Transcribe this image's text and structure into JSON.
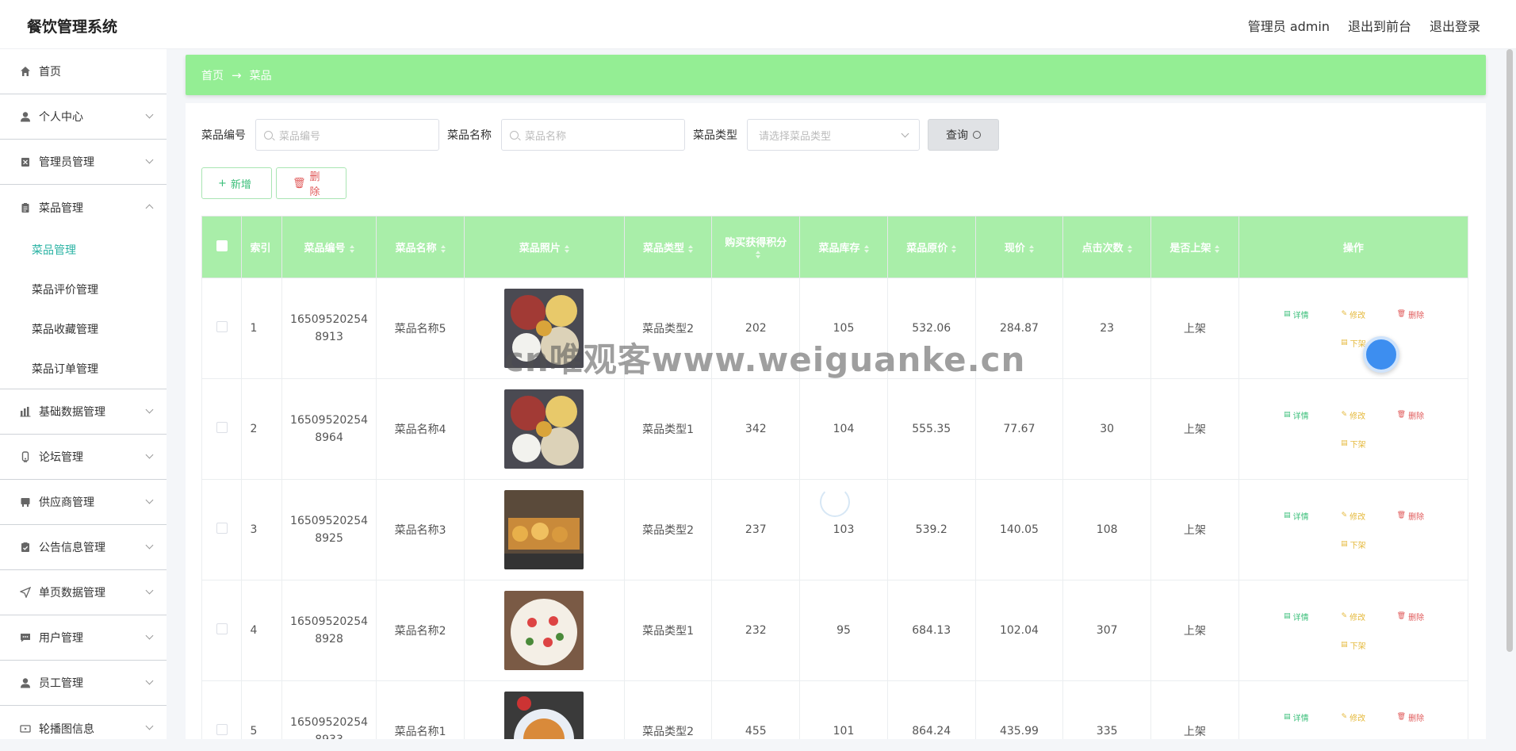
{
  "app": {
    "title": "餐饮管理系统"
  },
  "header": {
    "user_label": "管理员 admin",
    "to_front": "退出到前台",
    "logout": "退出登录"
  },
  "sidebar": {
    "items": [
      {
        "label": "首页",
        "icon": "home-icon"
      },
      {
        "label": "个人中心",
        "icon": "user-icon"
      },
      {
        "label": "管理员管理",
        "icon": "admin-icon"
      },
      {
        "label": "菜品管理",
        "icon": "clipboard-icon",
        "expanded": true
      },
      {
        "label": "基础数据管理",
        "icon": "chart-icon"
      },
      {
        "label": "论坛管理",
        "icon": "forum-icon"
      },
      {
        "label": "供应商管理",
        "icon": "supplier-icon"
      },
      {
        "label": "公告信息管理",
        "icon": "notice-icon"
      },
      {
        "label": "单页数据管理",
        "icon": "send-icon"
      },
      {
        "label": "用户管理",
        "icon": "chat-icon"
      },
      {
        "label": "员工管理",
        "icon": "staff-icon"
      },
      {
        "label": "轮播图信息",
        "icon": "carousel-icon"
      }
    ],
    "submenu": [
      "菜品管理",
      "菜品评价管理",
      "菜品收藏管理",
      "菜品订单管理"
    ]
  },
  "breadcrumb": {
    "home": "首页",
    "arrow": "→",
    "current": "菜品"
  },
  "search": {
    "code_label": "菜品编号",
    "code_placeholder": "菜品编号",
    "name_label": "菜品名称",
    "name_placeholder": "菜品名称",
    "type_label": "菜品类型",
    "type_placeholder": "请选择菜品类型",
    "query_label": "查询"
  },
  "actions": {
    "add_label": "新增",
    "delete_label": "删除"
  },
  "table": {
    "headers": [
      "索引",
      "菜品编号",
      "菜品名称",
      "菜品照片",
      "菜品类型",
      "购买获得积分",
      "菜品库存",
      "菜品原价",
      "现价",
      "点击次数",
      "是否上架",
      "操作"
    ],
    "ops": {
      "detail": "详情",
      "edit": "修改",
      "remove": "删除",
      "down": "下架"
    },
    "rows": [
      {
        "index": "1",
        "code": "16509520254 8913",
        "name": "菜品名称5",
        "type": "菜品类型2",
        "points": "202",
        "stock": "105",
        "price": "532.06",
        "now": "284.87",
        "clicks": "23",
        "on_sale": "上架",
        "photo": "plate-a"
      },
      {
        "index": "2",
        "code": "16509520254 8964",
        "name": "菜品名称4",
        "type": "菜品类型1",
        "points": "342",
        "stock": "104",
        "price": "555.35",
        "now": "77.67",
        "clicks": "30",
        "on_sale": "上架",
        "photo": "plate-a"
      },
      {
        "index": "3",
        "code": "16509520254 8925",
        "name": "菜品名称3",
        "type": "菜品类型2",
        "points": "237",
        "stock": "103",
        "price": "539.2",
        "now": "140.05",
        "clicks": "108",
        "on_sale": "上架",
        "photo": "skewers"
      },
      {
        "index": "4",
        "code": "16509520254 8928",
        "name": "菜品名称2",
        "type": "菜品类型1",
        "points": "232",
        "stock": "95",
        "price": "684.13",
        "now": "102.04",
        "clicks": "307",
        "on_sale": "上架",
        "photo": "pizza"
      },
      {
        "index": "5",
        "code": "16509520254 8933",
        "name": "菜品名称1",
        "type": "菜品类型2",
        "points": "455",
        "stock": "101",
        "price": "864.24",
        "now": "435.99",
        "clicks": "335",
        "on_sale": "上架",
        "photo": "pasta"
      }
    ]
  },
  "watermark": "cn唯观客www.weiguanke.cn",
  "colors": {
    "accent": "#2bb3a4",
    "header_green": "#a9eea9",
    "breadcrumb_green": "#94ee94",
    "danger": "#e05a5a",
    "warning": "#e5b93c",
    "success": "#3bbf7a"
  }
}
